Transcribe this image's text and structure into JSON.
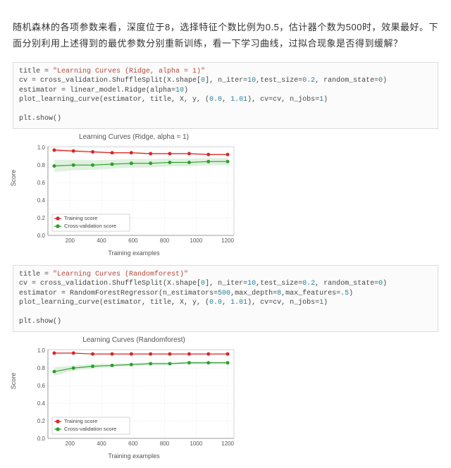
{
  "article": {
    "paragraph": "随机森林的各项参数来看，深度位于8，选择特征个数比例为0.5，估计器个数为500时，效果最好。下面分别利用上述得到的最优参数分别重新训练，看一下学习曲线，过拟合现象是否得到缓解？"
  },
  "code_ridge": {
    "l1a": "title = ",
    "l1s": "\"Learning Curves (Ridge, alpha = 1)\"",
    "l2a": "cv = cross_validation.ShuffleSplit(X.shape[",
    "l2n1": "0",
    "l2b": "], n_iter=",
    "l2n2": "10",
    "l2c": ",test_size=",
    "l2n3": "0.2",
    "l2d": ", random_state=",
    "l2n4": "0",
    "l2e": ")",
    "l3a": "estimator = linear_model.Ridge(alpha=",
    "l3n1": "10",
    "l3b": ")",
    "l4a": "plot_learning_curve(estimator, title, X, y, (",
    "l4n1": "0.0",
    "l4b": ", ",
    "l4n2": "1.01",
    "l4c": "), cv=cv, n_jobs=",
    "l4n3": "1",
    "l4d": ")",
    "blank": "",
    "l5": "plt.show()"
  },
  "code_rf": {
    "pfx": ": ",
    "l1a": "title = ",
    "l1s": "\"Learning Curves (Randomforest)\"",
    "l2a": "cv = cross_validation.ShuffleSplit(X.shape[",
    "l2n1": "0",
    "l2b": "], n_iter=",
    "l2n2": "10",
    "l2c": ",test_size=",
    "l2n3": "0.2",
    "l2d": ", random_state=",
    "l2n4": "0",
    "l2e": ")",
    "l3a": "estimator = RandomForestRegressor(n_estimators=",
    "l3n1": "500",
    "l3b": ",max_depth=",
    "l3n2": "8",
    "l3c": ",max_features=",
    "l3n3": ".5",
    "l3d": ")",
    "l4a": "plot_learning_curve(estimator, title, X, y, (",
    "l4n1": "0.0",
    "l4b": ", ",
    "l4n2": "1.01",
    "l4c": "), cv=cv, n_jobs=",
    "l4n3": "1",
    "l4d": ")",
    "blank": "",
    "l5": "plt.show()"
  },
  "chart_data": [
    {
      "id": "ridge",
      "type": "line",
      "title": "Learning Curves (Ridge, alpha = 1)",
      "xlabel": "Training examples",
      "ylabel": "Score",
      "x": [
        100,
        222,
        344,
        467,
        589,
        711,
        833,
        956,
        1078,
        1200
      ],
      "xticks": [
        200,
        400,
        600,
        800,
        1000,
        1200
      ],
      "yticks": [
        0.0,
        0.2,
        0.4,
        0.6,
        0.8,
        1.0
      ],
      "xlim": [
        60,
        1240
      ],
      "ylim": [
        0.0,
        1.01
      ],
      "series": [
        {
          "name": "Training score",
          "color": "#d62728",
          "values": [
            0.97,
            0.96,
            0.95,
            0.94,
            0.94,
            0.93,
            0.93,
            0.93,
            0.92,
            0.92
          ],
          "band": [
            0.02,
            0.015,
            0.012,
            0.01,
            0.01,
            0.009,
            0.009,
            0.008,
            0.008,
            0.008
          ]
        },
        {
          "name": "Cross-validation score",
          "color": "#2ca02c",
          "values": [
            0.79,
            0.8,
            0.8,
            0.81,
            0.82,
            0.82,
            0.83,
            0.83,
            0.84,
            0.84
          ],
          "band": [
            0.07,
            0.06,
            0.055,
            0.05,
            0.05,
            0.048,
            0.045,
            0.043,
            0.04,
            0.04
          ]
        }
      ],
      "legend": {
        "items": [
          "Training score",
          "Cross-validation score"
        ]
      }
    },
    {
      "id": "rf",
      "type": "line",
      "title": "Learning Curves (Randomforest)",
      "xlabel": "Training examples",
      "ylabel": "Score",
      "x": [
        100,
        222,
        344,
        467,
        589,
        711,
        833,
        956,
        1078,
        1200
      ],
      "xticks": [
        200,
        400,
        600,
        800,
        1000,
        1200
      ],
      "yticks": [
        0.0,
        0.2,
        0.4,
        0.6,
        0.8,
        1.0
      ],
      "xlim": [
        60,
        1240
      ],
      "ylim": [
        0.0,
        1.01
      ],
      "series": [
        {
          "name": "Training score",
          "color": "#d62728",
          "values": [
            0.97,
            0.97,
            0.96,
            0.96,
            0.96,
            0.96,
            0.96,
            0.96,
            0.96,
            0.96
          ],
          "band": [
            0.006,
            0.005,
            0.004,
            0.004,
            0.004,
            0.004,
            0.004,
            0.004,
            0.004,
            0.004
          ]
        },
        {
          "name": "Cross-validation score",
          "color": "#2ca02c",
          "values": [
            0.76,
            0.8,
            0.82,
            0.83,
            0.84,
            0.85,
            0.85,
            0.86,
            0.86,
            0.86
          ],
          "band": [
            0.05,
            0.03,
            0.025,
            0.02,
            0.018,
            0.016,
            0.015,
            0.014,
            0.013,
            0.012
          ]
        }
      ],
      "legend": {
        "items": [
          "Training score",
          "Cross-validation score"
        ]
      }
    }
  ]
}
